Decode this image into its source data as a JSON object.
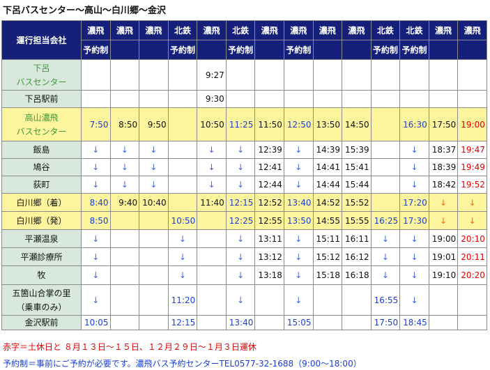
{
  "title": "下呂バスセンター〜高山〜白川郷〜金沢",
  "header": {
    "corner": "運行担当会社",
    "companies": [
      "濃飛",
      "濃飛",
      "濃飛",
      "北鉄",
      "濃飛",
      "北鉄",
      "濃飛",
      "濃飛",
      "濃飛",
      "濃飛",
      "北鉄",
      "北鉄",
      "濃飛",
      "濃飛"
    ],
    "reservation": [
      "予約制",
      "",
      "",
      "予約制",
      "",
      "予約制",
      "",
      "予約制",
      "",
      "",
      "予約制",
      "予約制",
      "",
      ""
    ]
  },
  "stops": [
    {
      "name": "下呂\nバスセンター",
      "green": true,
      "hl": false,
      "tall": true,
      "times": [
        "",
        "",
        "",
        "",
        "9:27",
        "",
        "",
        "",
        "",
        "",
        "",
        "",
        "",
        ""
      ],
      "colors": [
        "",
        "",
        "",
        "",
        "k",
        "",
        "",
        "",
        "",
        "",
        "",
        "",
        "",
        ""
      ]
    },
    {
      "name": "下呂駅前",
      "green": false,
      "hl": false,
      "tall": false,
      "times": [
        "",
        "",
        "",
        "",
        "9:30",
        "",
        "",
        "",
        "",
        "",
        "",
        "",
        "",
        ""
      ],
      "colors": [
        "",
        "",
        "",
        "",
        "k",
        "",
        "",
        "",
        "",
        "",
        "",
        "",
        "",
        ""
      ]
    },
    {
      "name": "高山濃飛\nバスセンター",
      "green": true,
      "hl": true,
      "tall": true,
      "times": [
        "7:50",
        "8:50",
        "9:50",
        "",
        "10:50",
        "11:25",
        "11:50",
        "12:50",
        "13:50",
        "14:50",
        "",
        "16:30",
        "17:50",
        "19:00"
      ],
      "colors": [
        "b",
        "k",
        "k",
        "",
        "k",
        "b",
        "k",
        "b",
        "k",
        "k",
        "",
        "b",
        "k",
        "r"
      ]
    },
    {
      "name": "飯島",
      "green": false,
      "hl": false,
      "tall": false,
      "times": [
        "↓",
        "↓",
        "↓",
        "",
        "↓",
        "↓",
        "12:39",
        "↓",
        "14:39",
        "15:39",
        "",
        "↓",
        "18:37",
        "19:47"
      ],
      "colors": [
        "a",
        "a",
        "a",
        "",
        "a",
        "a",
        "k",
        "a",
        "k",
        "k",
        "",
        "a",
        "k",
        "r"
      ]
    },
    {
      "name": "鳩谷",
      "green": false,
      "hl": false,
      "tall": false,
      "times": [
        "↓",
        "↓",
        "↓",
        "",
        "↓",
        "↓",
        "12:41",
        "↓",
        "14:41",
        "15:41",
        "",
        "↓",
        "18:39",
        "19:49"
      ],
      "colors": [
        "a",
        "a",
        "a",
        "",
        "a",
        "a",
        "k",
        "a",
        "k",
        "k",
        "",
        "a",
        "k",
        "r"
      ]
    },
    {
      "name": "荻町",
      "green": false,
      "hl": false,
      "tall": false,
      "times": [
        "↓",
        "↓",
        "↓",
        "",
        "↓",
        "↓",
        "12:44",
        "↓",
        "14:44",
        "15:44",
        "",
        "↓",
        "18:42",
        "19:52"
      ],
      "colors": [
        "a",
        "a",
        "a",
        "",
        "a",
        "a",
        "k",
        "a",
        "k",
        "k",
        "",
        "a",
        "k",
        "r"
      ]
    },
    {
      "name": "白川郷（着）",
      "green": false,
      "hl": true,
      "tall": false,
      "times": [
        "8:40",
        "9:40",
        "10:40",
        "",
        "11:40",
        "12:15",
        "12:52",
        "13:40",
        "14:52",
        "15:52",
        "",
        "17:20",
        "↓",
        "↓"
      ],
      "colors": [
        "b",
        "k",
        "k",
        "",
        "k",
        "b",
        "k",
        "b",
        "k",
        "k",
        "",
        "b",
        "oa",
        "ra"
      ]
    },
    {
      "name": "白川郷（発）",
      "green": false,
      "hl": true,
      "tall": false,
      "times": [
        "8:50",
        "",
        "",
        "10:50",
        "",
        "12:25",
        "12:55",
        "13:50",
        "14:55",
        "15:55",
        "16:25",
        "17:30",
        "↓",
        "↓"
      ],
      "colors": [
        "b",
        "",
        "",
        "b",
        "",
        "b",
        "k",
        "b",
        "k",
        "k",
        "b",
        "b",
        "oa",
        "ra"
      ]
    },
    {
      "name": "平瀬温泉",
      "green": false,
      "hl": false,
      "tall": false,
      "times": [
        "↓",
        "",
        "",
        "↓",
        "",
        "↓",
        "13:11",
        "↓",
        "15:11",
        "16:11",
        "↓",
        "↓",
        "19:00",
        "20:10"
      ],
      "colors": [
        "a",
        "",
        "",
        "a",
        "",
        "a",
        "k",
        "a",
        "k",
        "k",
        "a",
        "a",
        "k",
        "r"
      ]
    },
    {
      "name": "平瀬診療所",
      "green": false,
      "hl": false,
      "tall": false,
      "times": [
        "↓",
        "",
        "",
        "↓",
        "",
        "↓",
        "13:12",
        "↓",
        "15:12",
        "16:12",
        "↓",
        "↓",
        "19:01",
        "20:11"
      ],
      "colors": [
        "a",
        "",
        "",
        "a",
        "",
        "a",
        "k",
        "a",
        "k",
        "k",
        "a",
        "a",
        "k",
        "r"
      ]
    },
    {
      "name": "牧",
      "green": false,
      "hl": false,
      "tall": false,
      "times": [
        "↓",
        "",
        "",
        "↓",
        "",
        "↓",
        "13:18",
        "↓",
        "15:18",
        "16:18",
        "↓",
        "↓",
        "19:10",
        "20:20"
      ],
      "colors": [
        "a",
        "",
        "",
        "a",
        "",
        "a",
        "k",
        "a",
        "k",
        "k",
        "a",
        "a",
        "k",
        "r"
      ]
    },
    {
      "name": "五箇山合掌の里\n（乗車のみ）",
      "green": false,
      "hl": false,
      "tall": true,
      "times": [
        "↓",
        "",
        "",
        "11:20",
        "",
        "↓",
        "",
        "↓",
        "",
        "",
        "16:55",
        "↓",
        "",
        ""
      ],
      "colors": [
        "a",
        "",
        "",
        "b",
        "",
        "a",
        "",
        "a",
        "",
        "",
        "b",
        "a",
        "",
        ""
      ]
    },
    {
      "name": "金沢駅前",
      "green": false,
      "hl": false,
      "tall": false,
      "times": [
        "10:05",
        "",
        "",
        "12:15",
        "",
        "13:40",
        "",
        "15:05",
        "",
        "",
        "17:50",
        "18:45",
        "",
        ""
      ],
      "colors": [
        "b",
        "",
        "",
        "b",
        "",
        "b",
        "",
        "b",
        "",
        "",
        "b",
        "b",
        "",
        ""
      ]
    }
  ],
  "footer": {
    "note1": "赤字＝土休日と ８月１３日～１５日、１２月２９日～１月３日運休",
    "note2": "予約制＝事前にご予約が必要です。濃飛バス予約センターTEL0577-32-1688（9:00～18:00）"
  },
  "colors": {
    "header_bg": "#14207a",
    "highlight_row": "#fcf59e",
    "stop_bg": "#d8e8dc",
    "blue_time": "#1a3fd6",
    "red_time": "#e00000"
  }
}
